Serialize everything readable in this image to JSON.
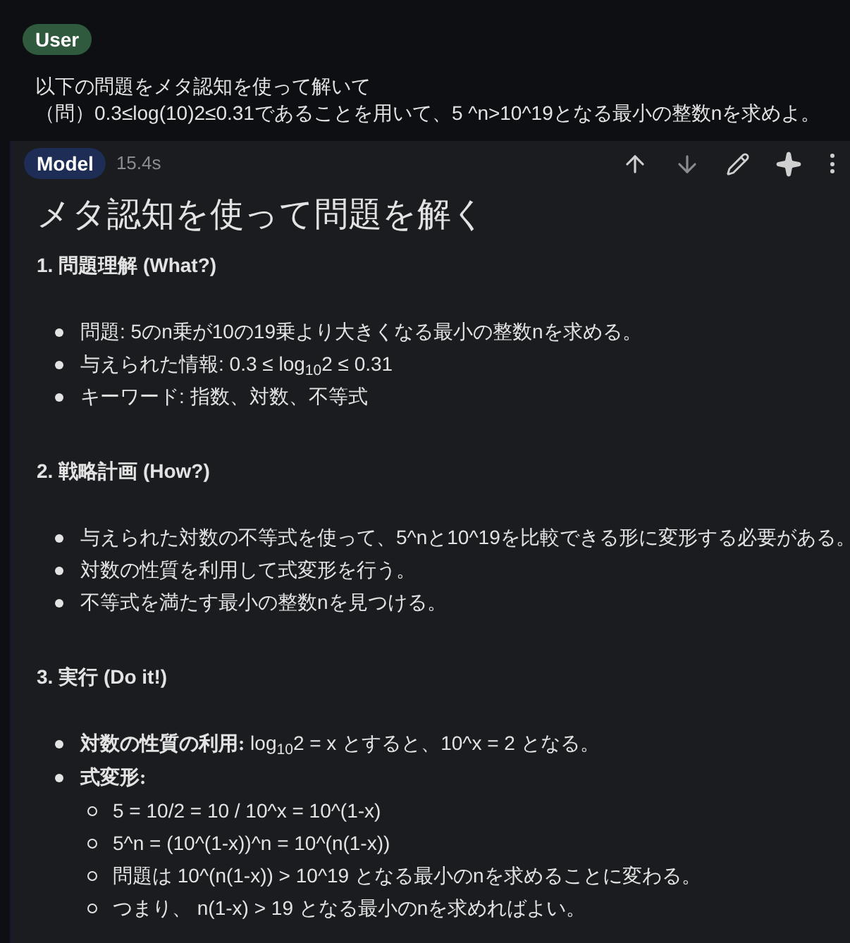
{
  "user": {
    "badge": "User",
    "lines": [
      "以下の問題をメタ認知を使って解いて",
      "（問）0.3≤log(10)2≤0.31であることを用いて、5 ^n>10^19となる最小の整数nを求めよ。"
    ]
  },
  "model": {
    "badge": "Model",
    "time": "15.4s",
    "title": "メタ認知を使って問題を解く",
    "sections": [
      {
        "heading": "1. 問題理解 (What?)",
        "items": [
          {
            "text": "問題: 5のn乗が10の19乗より大きくなる最小の整数nを求める。"
          },
          {
            "text": "与えられた情報: 0.3 ≤ log$_{10}$2 ≤ 0.31"
          },
          {
            "text": "キーワード: 指数、対数、不等式"
          }
        ]
      },
      {
        "heading": "2. 戦略計画 (How?)",
        "items": [
          {
            "text": "与えられた対数の不等式を使って、5^nと10^19を比較できる形に変形する必要がある。"
          },
          {
            "text": "対数の性質を利用して式変形を行う。"
          },
          {
            "text": "不等式を満たす最小の整数nを見つける。"
          }
        ]
      },
      {
        "heading": "3. 実行 (Do it!)",
        "items": [
          {
            "text": "**対数の性質の利用:** log$_{10}$2 = x とすると、10^x = 2 となる。"
          },
          {
            "text": "**式変形:**",
            "children": [
              {
                "text": "5 = 10/2 = 10 / 10^x = 10^(1-x)"
              },
              {
                "text": "5^n = (10^(1-x))^n = 10^(n(1-x))"
              },
              {
                "text": "問題は 10^(n(1-x)) > 10^19 となる最小のnを求めることに変わる。"
              },
              {
                "text": "つまり、 n(1-x) > 19 となる最小のnを求めればよい。"
              }
            ]
          }
        ]
      }
    ]
  }
}
